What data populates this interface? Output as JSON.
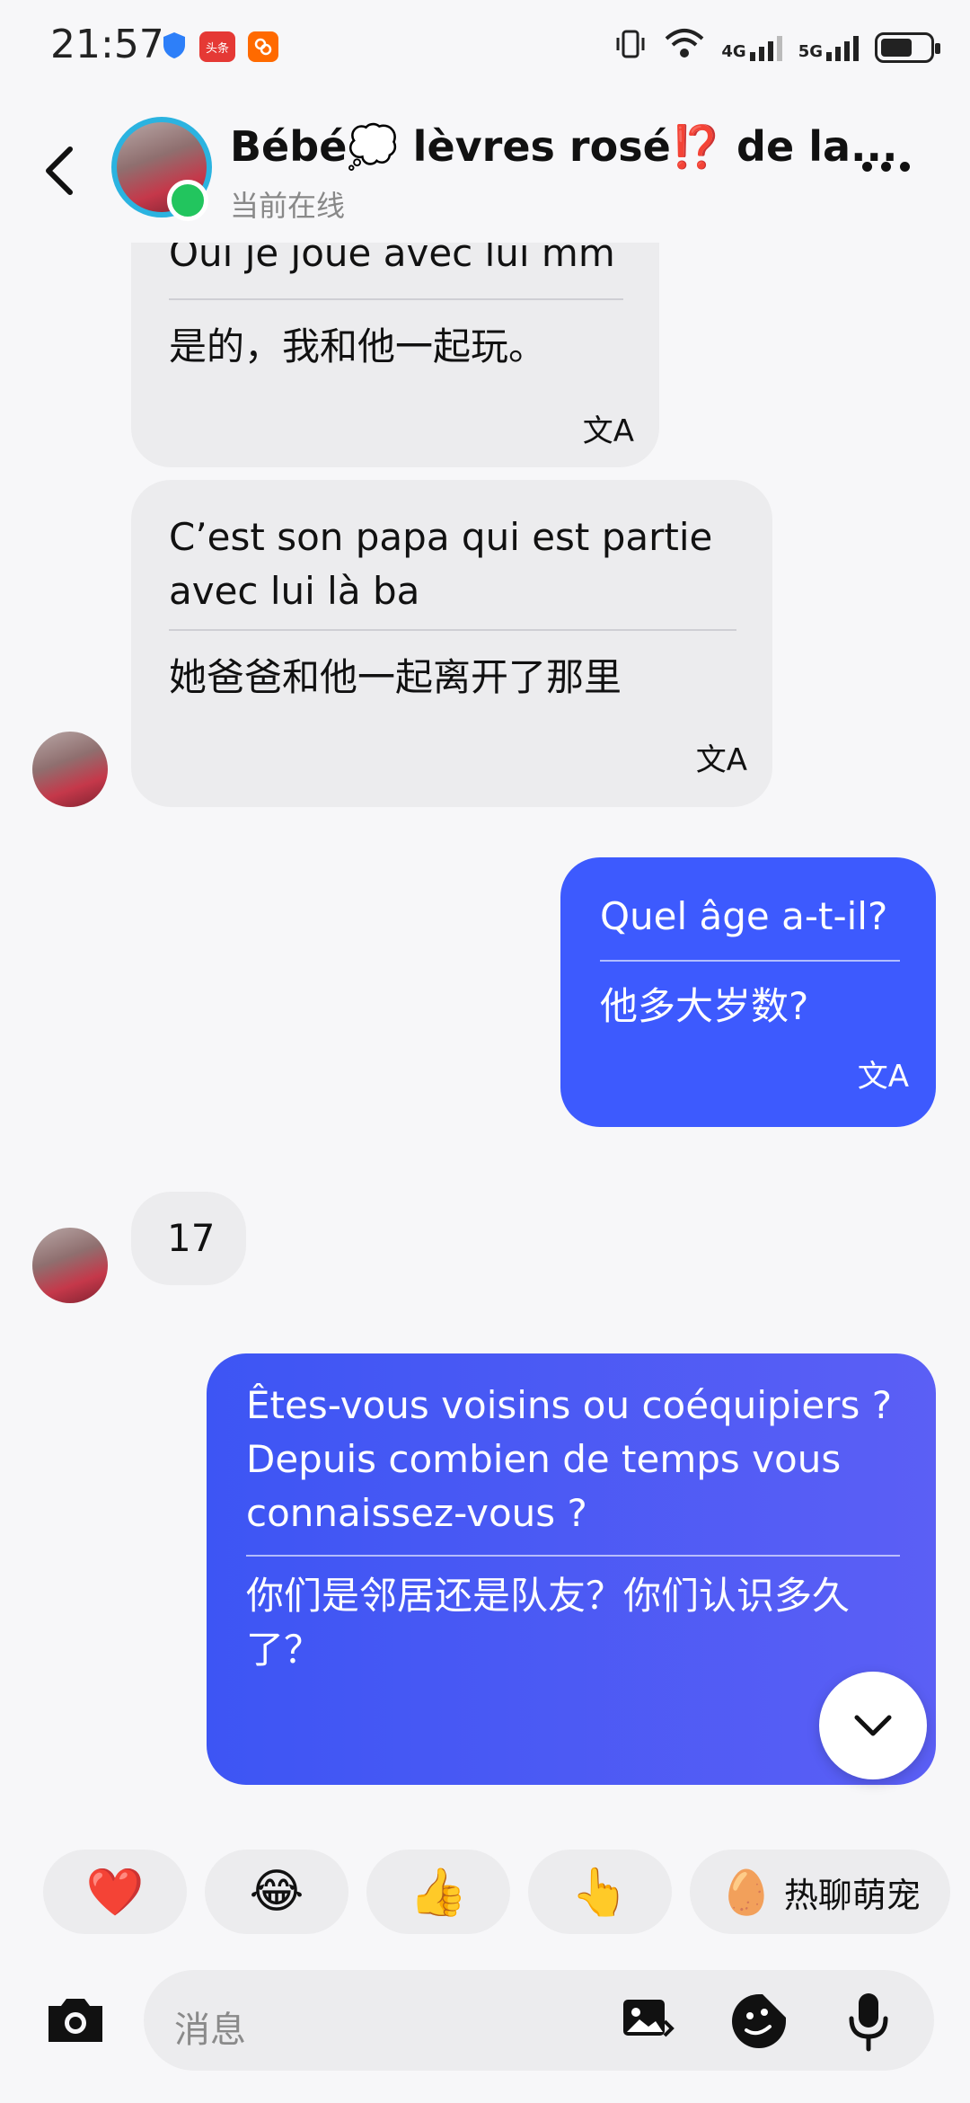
{
  "status_bar": {
    "time": "21:57",
    "badge_toutiao": "头条",
    "network_4g": "4G",
    "network_5g": "5G"
  },
  "header": {
    "contact_name": "Bébé💭 lèvres rosé⁉️ de la...",
    "contact_status": "当前在线"
  },
  "messages": [
    {
      "side": "incoming",
      "original": "Oui je joue avec lui mm",
      "translation": "是的，我和他一起玩。",
      "translate_icon": "文A"
    },
    {
      "side": "incoming",
      "original": "C’est son papa qui est partie avec lui là ba",
      "translation": "她爸爸和他一起离开了那里",
      "translate_icon": "文A"
    },
    {
      "side": "outgoing",
      "original": "Quel âge a-t-il?",
      "translation": "他多大岁数?",
      "translate_icon": "文A"
    },
    {
      "side": "incoming",
      "original": "17"
    },
    {
      "side": "outgoing",
      "original": "Êtes-vous voisins ou coéquipiers ? Depuis combien de temps vous connaissez-vous ?",
      "translation": "你们是邻居还是队友？你们认识多久了？"
    }
  ],
  "quick_replies": {
    "heart": "❤️",
    "laugh": "😂",
    "thumbs_up": "👍",
    "point": "👆",
    "hot_chat_emoji": "🥚",
    "hot_chat_label": "热聊萌宠"
  },
  "input": {
    "placeholder": "消息"
  },
  "colors": {
    "outgoing_bubble": "#3d5afe",
    "incoming_bubble": "#ececee",
    "online": "#22c55e",
    "avatar_ring": "#2bb3e0"
  }
}
